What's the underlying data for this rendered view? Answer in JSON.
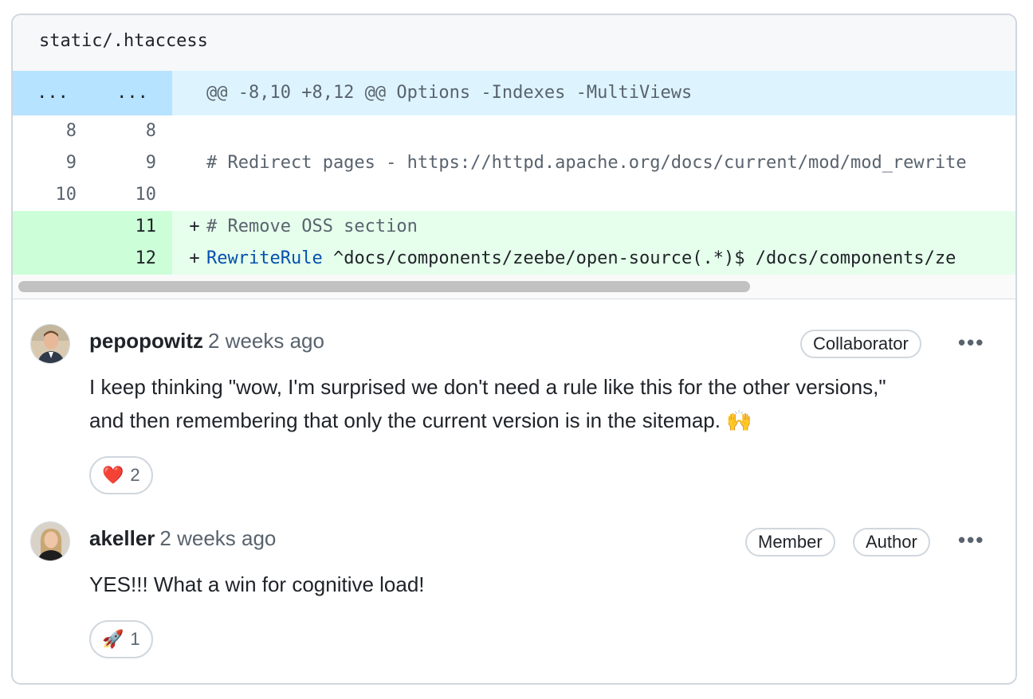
{
  "file": {
    "path": "static/.htaccess"
  },
  "diff": {
    "hunk": {
      "old": "...",
      "new": "...",
      "header": "@@ -8,10 +8,12 @@ Options -Indexes -MultiViews"
    },
    "lines": [
      {
        "old": "8",
        "new": "8",
        "marker": "",
        "text": ""
      },
      {
        "old": "9",
        "new": "9",
        "marker": "",
        "text": "# Redirect pages - https://httpd.apache.org/docs/current/mod/mod_rewrite"
      },
      {
        "old": "10",
        "new": "10",
        "marker": "",
        "text": ""
      },
      {
        "old": "",
        "new": "11",
        "marker": "+",
        "text": "# Remove OSS section"
      },
      {
        "old": "",
        "new": "12",
        "marker": "+",
        "keyword": "RewriteRule",
        "text": " ^docs/components/zeebe/open-source(.*)$ /docs/components/ze"
      }
    ]
  },
  "comments": [
    {
      "author": "pepopowitz",
      "time": "2 weeks ago",
      "badges": [
        "Collaborator"
      ],
      "more": "•••",
      "body_line1": "I keep thinking \"wow, I'm surprised we don't need a rule like this for the other versions,\"",
      "body_line2": "and then remembering that only the current version is in the sitemap. 🙌",
      "reaction": {
        "emoji": "❤️",
        "count": "2"
      }
    },
    {
      "author": "akeller",
      "time": "2 weeks ago",
      "badges": [
        "Member",
        "Author"
      ],
      "more": "•••",
      "body_line1": "YES!!! What a win for cognitive load!",
      "reaction": {
        "emoji": "🚀",
        "count": "1"
      }
    }
  ],
  "colors": {
    "hunk_bg": "#ddf4ff",
    "hunk_num_bg": "#b6e3ff",
    "add_bg": "#e6ffec",
    "add_num_bg": "#ccffd8",
    "border": "#d0d7de",
    "muted": "#59636e",
    "keyword": "#0550ae"
  }
}
